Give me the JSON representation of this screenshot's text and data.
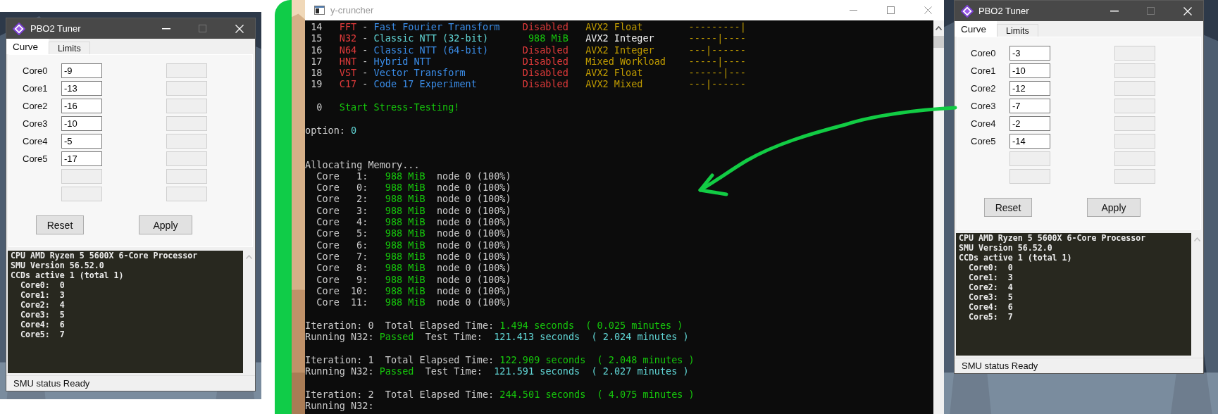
{
  "tuner_windows": [
    {
      "title": "PBO2 Tuner",
      "tabs": [
        {
          "label": "Curve",
          "selected": true
        },
        {
          "label": "Limits",
          "selected": false
        }
      ],
      "rows": [
        {
          "label": "Core0",
          "fields": [
            {
              "value": "-9",
              "disabled": false
            },
            {
              "disabled": true
            }
          ]
        },
        {
          "label": "Core1",
          "fields": [
            {
              "value": "-13",
              "disabled": false
            },
            {
              "disabled": true
            }
          ]
        },
        {
          "label": "Core2",
          "fields": [
            {
              "value": "-16",
              "disabled": false
            },
            {
              "disabled": true
            }
          ]
        },
        {
          "label": "Core3",
          "fields": [
            {
              "value": "-10",
              "disabled": false
            },
            {
              "disabled": true
            }
          ]
        },
        {
          "label": "Core4",
          "fields": [
            {
              "value": "-5",
              "disabled": false
            },
            {
              "disabled": true
            }
          ]
        },
        {
          "label": "Core5",
          "fields": [
            {
              "value": "-17",
              "disabled": false
            },
            {
              "disabled": true
            }
          ]
        },
        {
          "fields": [
            {
              "disabled": true
            },
            {
              "disabled": true
            }
          ]
        },
        {
          "fields": [
            {
              "disabled": true
            },
            {
              "disabled": true
            }
          ]
        }
      ],
      "buttons": [
        "Reset",
        "Apply"
      ],
      "log": {
        "lines": [
          "CPU AMD Ryzen 5 5600X 6-Core Processor",
          "SMU Version 56.52.0",
          "CCDs active 1 (total 1)"
        ],
        "cores": [
          {
            "core": "Core0:",
            "value": "0"
          },
          {
            "core": "Core1:",
            "value": "3"
          },
          {
            "core": "Core2:",
            "value": "4"
          },
          {
            "core": "Core3:",
            "value": "5"
          },
          {
            "core": "Core4:",
            "value": "6"
          },
          {
            "core": "Core5:",
            "value": "7"
          }
        ]
      },
      "status": "SMU status Ready"
    },
    {
      "title": "PBO2 Tuner",
      "tabs": [
        {
          "label": "Curve",
          "selected": true
        },
        {
          "label": "Limits",
          "selected": false
        }
      ],
      "rows": [
        {
          "label": "Core0",
          "fields": [
            {
              "value": "-3",
              "disabled": false
            },
            {
              "disabled": true
            }
          ]
        },
        {
          "label": "Core1",
          "fields": [
            {
              "value": "-10",
              "disabled": false
            },
            {
              "disabled": true
            }
          ]
        },
        {
          "label": "Core2",
          "fields": [
            {
              "value": "-12",
              "disabled": false
            },
            {
              "disabled": true
            }
          ]
        },
        {
          "label": "Core3",
          "fields": [
            {
              "value": "-7",
              "disabled": false
            },
            {
              "disabled": true
            }
          ]
        },
        {
          "label": "Core4",
          "fields": [
            {
              "value": "-2",
              "disabled": false
            },
            {
              "disabled": true
            }
          ]
        },
        {
          "label": "Core5",
          "fields": [
            {
              "value": "-14",
              "disabled": false
            },
            {
              "disabled": true
            }
          ]
        },
        {
          "fields": [
            {
              "disabled": true
            },
            {
              "disabled": true
            }
          ]
        },
        {
          "fields": [
            {
              "disabled": true
            },
            {
              "disabled": true
            }
          ]
        }
      ],
      "buttons": [
        "Reset",
        "Apply"
      ],
      "log": {
        "lines": [
          "CPU AMD Ryzen 5 5600X 6-Core Processor",
          "SMU Version 56.52.0",
          "CCDs active 1 (total 1)"
        ],
        "cores": [
          {
            "core": "Core0:",
            "value": "0"
          },
          {
            "core": "Core1:",
            "value": "3"
          },
          {
            "core": "Core2:",
            "value": "4"
          },
          {
            "core": "Core3:",
            "value": "5"
          },
          {
            "core": "Core4:",
            "value": "6"
          },
          {
            "core": "Core5:",
            "value": "7"
          }
        ]
      },
      "status": "SMU status Ready"
    }
  ],
  "console": {
    "title": "y-cruncher",
    "tests": [
      {
        "number": "14",
        "code": "FFT",
        "separator": "-",
        "name": "Fast Fourier Transform",
        "status": "Disabled",
        "instruction_set": "AVX2 Float",
        "bar": "---------|",
        "enabled": false
      },
      {
        "number": "15",
        "code": "N32",
        "separator": "-",
        "name": "Classic NTT (32-bit)",
        "status": "988 MiB",
        "instruction_set": "AVX2 Integer",
        "bar": "-----|----",
        "enabled": true
      },
      {
        "number": "16",
        "code": "N64",
        "separator": "-",
        "name": "Classic NTT (64-bit)",
        "status": "Disabled",
        "instruction_set": "AVX2 Integer",
        "bar": "---|------",
        "enabled": false
      },
      {
        "number": "17",
        "code": "HNT",
        "separator": "-",
        "name": "Hybrid NTT",
        "status": "Disabled",
        "instruction_set": "Mixed Workload",
        "bar": "-----|----",
        "enabled": false
      },
      {
        "number": "18",
        "code": "VST",
        "separator": "-",
        "name": "Vector Transform",
        "status": "Disabled",
        "instruction_set": "AVX2 Float",
        "bar": "------|---",
        "enabled": false
      },
      {
        "number": "19",
        "code": "C17",
        "separator": "-",
        "name": "Code 17 Experiment",
        "status": "Disabled",
        "instruction_set": "AVX2 Mixed",
        "bar": "---|------",
        "enabled": false
      }
    ],
    "start_option": {
      "number": "0",
      "label": "Start Stress-Testing!"
    },
    "prompt": {
      "label": "option:",
      "value": "0"
    },
    "allocation": {
      "header": "Allocating Memory...",
      "cores": [
        {
          "label": "Core",
          "index": "1:",
          "size": "988 MiB",
          "node": "node 0 (100%)"
        },
        {
          "label": "Core",
          "index": "0:",
          "size": "988 MiB",
          "node": "node 0 (100%)"
        },
        {
          "label": "Core",
          "index": "2:",
          "size": "988 MiB",
          "node": "node 0 (100%)"
        },
        {
          "label": "Core",
          "index": "3:",
          "size": "988 MiB",
          "node": "node 0 (100%)"
        },
        {
          "label": "Core",
          "index": "4:",
          "size": "988 MiB",
          "node": "node 0 (100%)"
        },
        {
          "label": "Core",
          "index": "5:",
          "size": "988 MiB",
          "node": "node 0 (100%)"
        },
        {
          "label": "Core",
          "index": "6:",
          "size": "988 MiB",
          "node": "node 0 (100%)"
        },
        {
          "label": "Core",
          "index": "7:",
          "size": "988 MiB",
          "node": "node 0 (100%)"
        },
        {
          "label": "Core",
          "index": "8:",
          "size": "988 MiB",
          "node": "node 0 (100%)"
        },
        {
          "label": "Core",
          "index": "9:",
          "size": "988 MiB",
          "node": "node 0 (100%)"
        },
        {
          "label": "Core",
          "index": "10:",
          "size": "988 MiB",
          "node": "node 0 (100%)"
        },
        {
          "label": "Core",
          "index": "11:",
          "size": "988 MiB",
          "node": "node 0 (100%)"
        }
      ]
    },
    "iterations": [
      {
        "label": "Iteration:",
        "number": "0",
        "elapsed_label": "Total Elapsed Time:",
        "elapsed": "1.494 seconds",
        "elapsed_minutes": "( 0.025 minutes )",
        "test_label": "Running N32:",
        "result": "Passed",
        "test_time_label": "Test Time:",
        "test_time": "121.413 seconds",
        "test_minutes": "( 2.024 minutes )"
      },
      {
        "label": "Iteration:",
        "number": "1",
        "elapsed_label": "Total Elapsed Time:",
        "elapsed": "122.909 seconds",
        "elapsed_minutes": "( 2.048 minutes )",
        "test_label": "Running N32:",
        "result": "Passed",
        "test_time_label": "Test Time:",
        "test_time": "121.591 seconds",
        "test_minutes": "( 2.027 minutes )"
      },
      {
        "label": "Iteration:",
        "number": "2",
        "elapsed_label": "Total Elapsed Time:",
        "elapsed": "244.501 seconds",
        "elapsed_minutes": "( 4.075 minutes )",
        "test_label": "Running N32:"
      }
    ]
  }
}
